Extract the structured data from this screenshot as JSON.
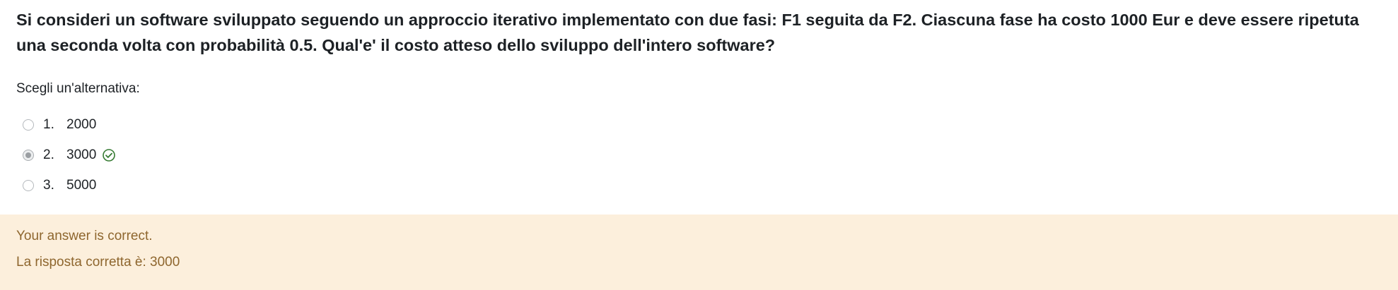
{
  "question": {
    "text": "Si consideri un software sviluppato seguendo un approccio iterativo implementato con due fasi: F1 seguita da F2. Ciascuna fase ha costo 1000 Eur e deve essere ripetuta una seconda volta con probabilità 0.5. Qual'e' il costo atteso dello sviluppo dell'intero software?"
  },
  "prompt": "Scegli un'alternativa:",
  "answers": [
    {
      "number": "1.",
      "value": "2000",
      "selected": false
    },
    {
      "number": "2.",
      "value": "3000",
      "selected": true,
      "icon": "check-circle-icon"
    },
    {
      "number": "3.",
      "value": "5000",
      "selected": false
    }
  ],
  "feedback": {
    "status": "Your answer is correct.",
    "right_answer": "La risposta corretta è: 3000"
  },
  "colors": {
    "feedback_background": "#fcefdc",
    "feedback_text": "#8e662e",
    "correct_icon": "#357a32"
  }
}
